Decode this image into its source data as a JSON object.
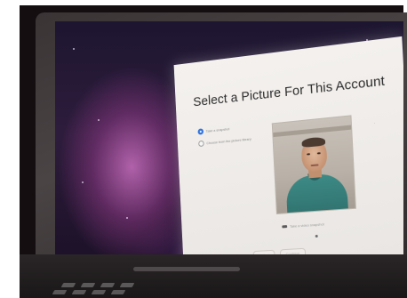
{
  "dialog": {
    "title": "Select a Picture For This Account",
    "options": [
      {
        "label": "Take a snapshot",
        "selected": true
      },
      {
        "label": "Choose from the picture library",
        "selected": false
      }
    ],
    "caption": "Take a video snapshot",
    "buttons": {
      "back": "Go Back",
      "continue": "Continue"
    }
  },
  "colors": {
    "accent": "#3b7be0",
    "wallpaper": "#2e1c3c",
    "dialog": "#f1eeeb"
  }
}
